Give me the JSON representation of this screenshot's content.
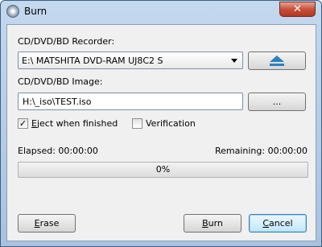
{
  "window": {
    "title": "Burn",
    "close_glyph": "✕"
  },
  "recorder": {
    "label": "CD/DVD/BD Recorder:",
    "selected": "E:\\ MATSHITA  DVD-RAM UJ8C2 S",
    "eject_icon": "eject-icon"
  },
  "image": {
    "label": "CD/DVD/BD Image:",
    "path": "H:\\_iso\\TEST.iso",
    "browse_label": "..."
  },
  "options": {
    "eject": {
      "label_rest": "ject when finished",
      "mnemonic": "E",
      "checked": true
    },
    "verify": {
      "label": "Verification",
      "checked": false
    }
  },
  "status": {
    "elapsed": "Elapsed: 00:00:00",
    "remaining": "Remaining: 00:00:00",
    "progress": 0,
    "progress_text": "0%"
  },
  "buttons": {
    "erase": {
      "mnemonic": "E",
      "rest": "rase"
    },
    "burn": {
      "mnemonic": "B",
      "rest": "urn"
    },
    "cancel": {
      "mnemonic": "C",
      "rest": "ancel"
    }
  },
  "colors": {
    "progress_fill": "#25b125",
    "title_bar": "#b8cde7",
    "dialog_bg": "#f0f0f0"
  }
}
